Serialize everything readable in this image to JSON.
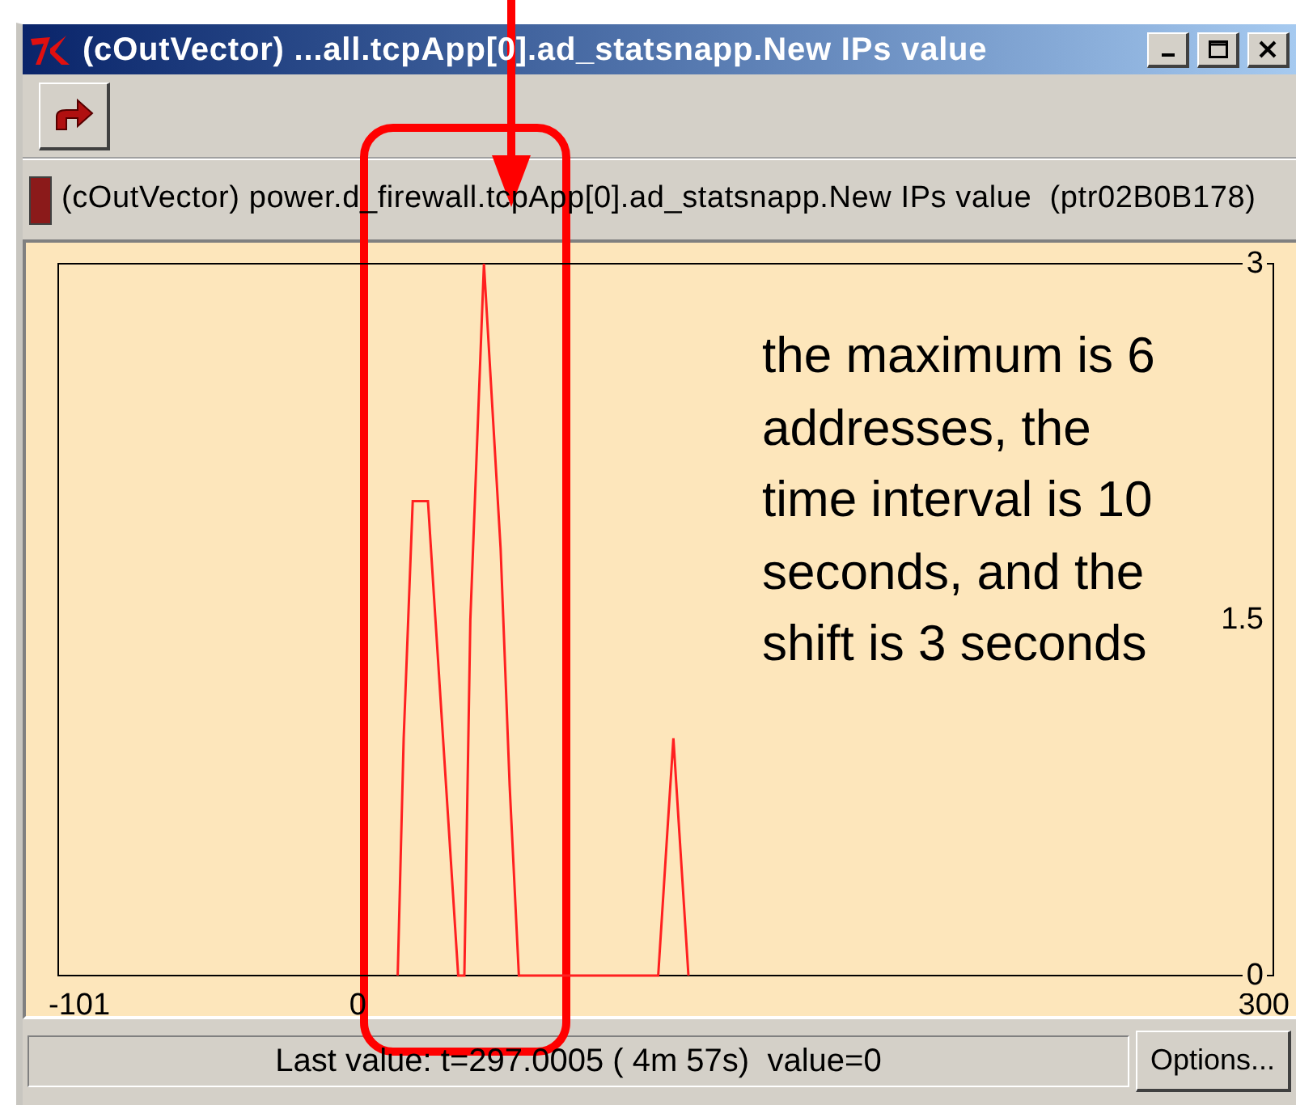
{
  "window": {
    "title": "(cOutVector) ...all.tcpApp[0].ad_statsnapp.New IPs value"
  },
  "object_info": {
    "color": "#8b1a1a",
    "text": "(cOutVector) power.d_firewall.tcpApp[0].ad_statsnapp.New IPs value  (ptr02B0B178)"
  },
  "chart": {
    "chart_data": {
      "type": "line",
      "xlim": [
        -101,
        300
      ],
      "ylim": [
        0,
        3
      ],
      "xticks": [
        -101,
        0,
        300
      ],
      "yticks": [
        0,
        1.5,
        3
      ],
      "series": [
        {
          "color": "#ff2020",
          "x": [
            11,
            13,
            16,
            18,
            21,
            23,
            27,
            31,
            33,
            35,
            39.5,
            45,
            48,
            51,
            97,
            100,
            102,
            104,
            107
          ],
          "values": [
            0,
            1,
            2,
            2,
            2,
            1.6,
            0.8,
            0,
            0,
            1.5,
            3,
            1.8,
            0.8,
            0,
            0,
            0.6,
            1,
            0.6,
            0
          ]
        }
      ]
    }
  },
  "status_bar": {
    "text": "Last value: t=297.0005 ( 4m 57s)  value=0",
    "button": "Options..."
  },
  "annotation": {
    "text": "the maximum is 6 addresses, the time interval is 10 seconds, and the shift is 3 seconds"
  }
}
